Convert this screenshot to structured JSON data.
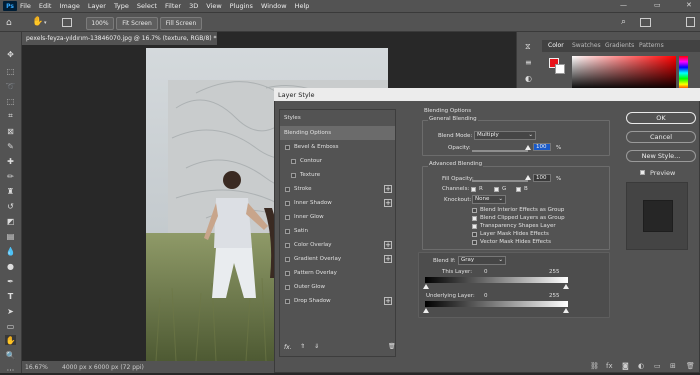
{
  "menubar": {
    "logo": "Ps",
    "items": [
      "File",
      "Edit",
      "Image",
      "Layer",
      "Type",
      "Select",
      "Filter",
      "3D",
      "View",
      "Plugins",
      "Window",
      "Help"
    ]
  },
  "optbar": {
    "zoom": "100%",
    "fit_screen": "Fit Screen",
    "fill_screen": "Fill Screen"
  },
  "document": {
    "tab": "pexels-feyza-yıldırım-13846070.jpg @ 16.7% (texture, RGB/8) *",
    "zoom": "16.67%",
    "info": "4000 px x 6000 px (72 ppi)"
  },
  "panel": {
    "tabs": [
      "Color",
      "Swatches",
      "Gradients",
      "Patterns"
    ]
  },
  "dialog": {
    "title": "Layer Style",
    "styles_header": "Styles",
    "styles": [
      {
        "label": "Blending Options",
        "checkbox": false,
        "plus": false,
        "selected": true
      },
      {
        "label": "Bevel & Emboss",
        "checkbox": true,
        "plus": false
      },
      {
        "label": "Contour",
        "checkbox": true,
        "plus": false,
        "indent": true
      },
      {
        "label": "Texture",
        "checkbox": true,
        "plus": false,
        "indent": true
      },
      {
        "label": "Stroke",
        "checkbox": true,
        "plus": true
      },
      {
        "label": "Inner Shadow",
        "checkbox": true,
        "plus": true
      },
      {
        "label": "Inner Glow",
        "checkbox": true,
        "plus": false
      },
      {
        "label": "Satin",
        "checkbox": true,
        "plus": false
      },
      {
        "label": "Color Overlay",
        "checkbox": true,
        "plus": true
      },
      {
        "label": "Gradient Overlay",
        "checkbox": true,
        "plus": true
      },
      {
        "label": "Pattern Overlay",
        "checkbox": true,
        "plus": false
      },
      {
        "label": "Outer Glow",
        "checkbox": true,
        "plus": false
      },
      {
        "label": "Drop Shadow",
        "checkbox": true,
        "plus": true
      }
    ],
    "fx": "fx.",
    "blending_options": "Blending Options",
    "general_blending": "General Blending",
    "blend_mode_label": "Blend Mode:",
    "blend_mode_value": "Multiply",
    "opacity_label": "Opacity:",
    "opacity_value": "100",
    "percent": "%",
    "advanced_blending": "Advanced Blending",
    "fill_opacity_label": "Fill Opacity:",
    "fill_opacity_value": "100",
    "channels_label": "Channels:",
    "channel_r": "R",
    "channel_g": "G",
    "channel_b": "B",
    "knockout_label": "Knockout:",
    "knockout_value": "None",
    "adv_checks": [
      {
        "label": "Blend Interior Effects as Group",
        "checked": false
      },
      {
        "label": "Blend Clipped Layers as Group",
        "checked": true
      },
      {
        "label": "Transparency Shapes Layer",
        "checked": true
      },
      {
        "label": "Layer Mask Hides Effects",
        "checked": false
      },
      {
        "label": "Vector Mask Hides Effects",
        "checked": false
      }
    ],
    "blend_if_label": "Blend If:",
    "blend_if_value": "Gray",
    "this_layer_label": "This Layer:",
    "this_layer_min": "0",
    "this_layer_max": "255",
    "underlying_label": "Underlying Layer:",
    "underlying_min": "0",
    "underlying_max": "255",
    "buttons": {
      "ok": "OK",
      "cancel": "Cancel",
      "new_style": "New Style...",
      "preview": "Preview"
    }
  }
}
